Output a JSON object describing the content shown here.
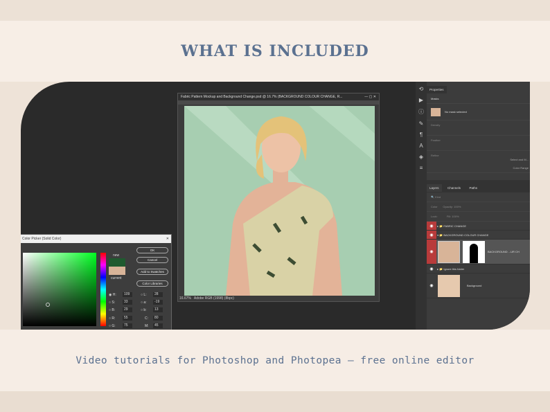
{
  "heading": "WHAT IS INCLUDED",
  "caption": "Video tutorials for Photoshop and Photopea – free online editor",
  "document": {
    "title": "Fabric Pattern Mockup and Background Change.psd @ 16.7% (BACKGROUND COLOUR CHANGE, R...",
    "zoom": "16.67%",
    "status": "Adobe RGB (1998) (8bpc)"
  },
  "properties": {
    "tab": "Properties",
    "mask_label": "Masks",
    "no_mask": "No mask selected",
    "density": "Density",
    "feather": "Feather",
    "refine": "Refine",
    "select_and_mask": "Select and M...",
    "color_range": "Color Range"
  },
  "layers_panel": {
    "tabs": [
      "Layers",
      "Channels",
      "Paths"
    ],
    "kind": "Kind",
    "mode": "Color",
    "opacity_label": "Opacity:",
    "opacity": "100%",
    "lock": "Lock:",
    "fill_label": "Fill:",
    "fill": "100%",
    "layers": [
      "FABRIC CHANGE",
      "BACKGROUND COLOUR CHANGE",
      "BACKGROUND ...UR CH",
      "Ignore this folder",
      "Background"
    ]
  },
  "picker": {
    "title": "Color Picker (Solid Color)",
    "new": "new",
    "current": "current",
    "ok": "OK",
    "cancel": "Cancel",
    "add": "Add to Swatches",
    "libraries": "Color Libraries",
    "H": "109",
    "S": "33",
    "B": "29",
    "R": "55",
    "G": "75",
    "L": "28",
    "a": "-19",
    "b": "13",
    "C": "80",
    "M": "45"
  },
  "colors": {
    "title": "#5b7190",
    "new_swatch": "#1f5a2f",
    "current_swatch": "#d8b498"
  }
}
